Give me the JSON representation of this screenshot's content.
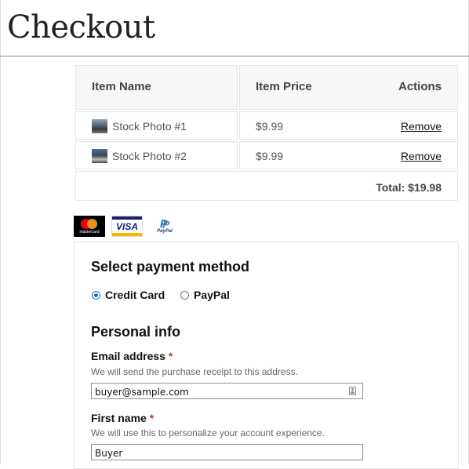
{
  "page": {
    "title": "Checkout"
  },
  "cart": {
    "headers": {
      "name": "Item Name",
      "price": "Item Price",
      "actions": "Actions"
    },
    "items": [
      {
        "name": "Stock Photo #1",
        "price": "$9.99",
        "action": "Remove"
      },
      {
        "name": "Stock Photo #2",
        "price": "$9.99",
        "action": "Remove"
      }
    ],
    "total": "Total: $19.98"
  },
  "badges": {
    "mastercard": "mastercard",
    "visa": "VISA",
    "paypal": "PayPal"
  },
  "payment": {
    "title": "Select payment method",
    "options": [
      {
        "label": "Credit Card",
        "selected": true
      },
      {
        "label": "PayPal",
        "selected": false
      }
    ]
  },
  "personal": {
    "title": "Personal info",
    "email": {
      "label": "Email address",
      "required_mark": "*",
      "help": "We will send the purchase receipt to this address.",
      "value": "buyer@sample.com"
    },
    "first_name": {
      "label": "First name",
      "required_mark": "*",
      "help": "We will use this to personalize your account experience.",
      "value": "Buyer"
    }
  },
  "colors": {
    "accent": "#1a6fd0",
    "required": "#a94a1e",
    "header_bg": "#f7f7f7"
  }
}
